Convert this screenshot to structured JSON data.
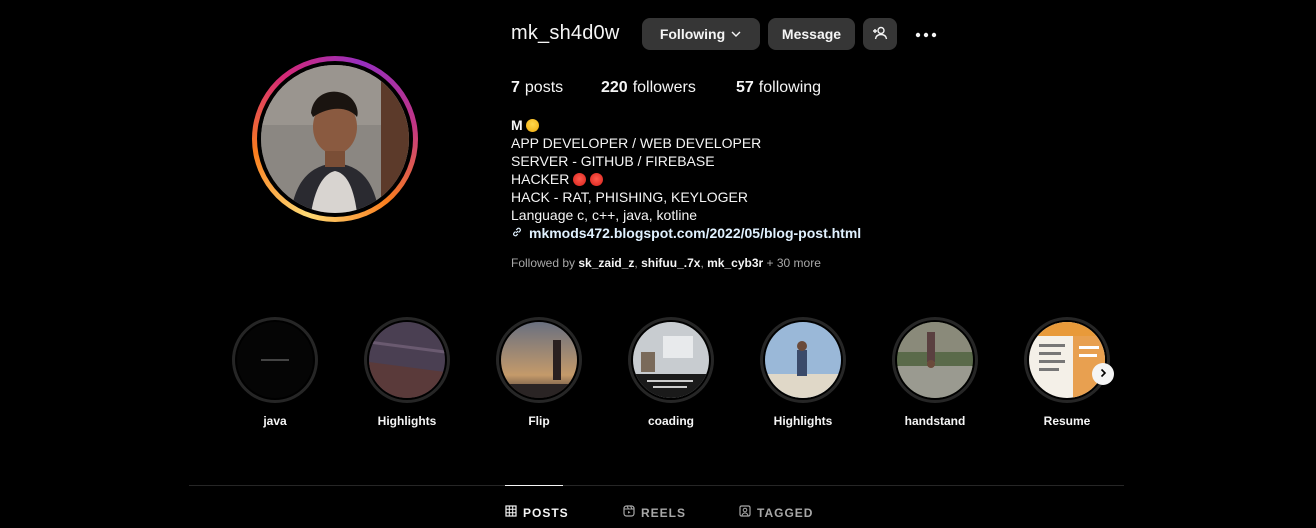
{
  "profile": {
    "username": "mk_sh4d0w",
    "following_label": "Following",
    "message_label": "Message"
  },
  "stats": {
    "posts_count": "7",
    "posts_label": "posts",
    "followers_count": "220",
    "followers_label": "followers",
    "following_count": "57",
    "following_label": "following"
  },
  "bio": {
    "name": "M",
    "lines": [
      "APP DEVELOPER / WEB DEVELOPER",
      "SERVER - GITHUB / FIREBASE",
      "HACKER",
      "HACK - RAT, PHISHING, KEYLOGER",
      "Language c, c++, java, kotline"
    ],
    "link": "mkmods472.blogspot.com/2022/05/blog-post.html"
  },
  "followed_by": {
    "prefix": "Followed by",
    "users": [
      "sk_zaid_z",
      "shifuu_.7x",
      "mk_cyb3r"
    ],
    "more": "+ 30 more"
  },
  "highlights": [
    {
      "label": "java"
    },
    {
      "label": "Highlights"
    },
    {
      "label": "Flip"
    },
    {
      "label": "coading"
    },
    {
      "label": "Highlights"
    },
    {
      "label": "handstand"
    },
    {
      "label": "Resume"
    }
  ],
  "tabs": [
    {
      "label": "POSTS",
      "icon": "grid-icon",
      "active": true
    },
    {
      "label": "REELS",
      "icon": "reels-icon",
      "active": false
    },
    {
      "label": "TAGGED",
      "icon": "tagged-icon",
      "active": false
    }
  ],
  "colors": {
    "background": "#000000",
    "button": "#363636",
    "text": "#f5f5f5",
    "secondary_text": "#a8a8a8",
    "link": "#e0f1ff"
  }
}
